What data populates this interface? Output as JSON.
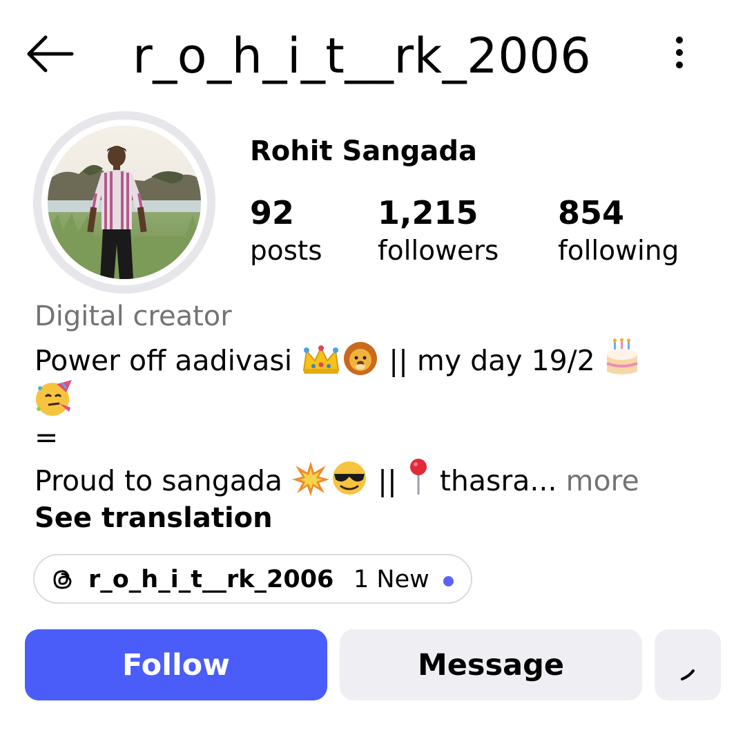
{
  "header": {
    "back_icon": "arrow-left-icon",
    "username": "r_o_h_i_t__rk_2006",
    "more_icon": "vertical-dots-icon"
  },
  "profile": {
    "name": "Rohit Sangada",
    "avatar": "profile-photo"
  },
  "stats": [
    {
      "value": "92",
      "label": "posts"
    },
    {
      "value": "1,215",
      "label": "followers"
    },
    {
      "value": "854",
      "label": "following"
    }
  ],
  "bio": {
    "category": "Digital creator",
    "line1_text": "Power off aadivasi ",
    "line1_after": " || my day 19/2",
    "line3": "=",
    "line4_text": "Proud to sangada ",
    "line4_mid": " || ",
    "line4_end": "thasra... ",
    "more_label": "more",
    "see_translation": "See translation",
    "emojis": [
      "crown",
      "lion",
      "birthday-cake",
      "partying-face",
      "collision",
      "sunglasses-face",
      "round-pushpin"
    ]
  },
  "threads": {
    "icon": "threads-icon",
    "handle": "r_o_h_i_t__rk_2006",
    "new_label": "1 New",
    "dot_color": "#5b63f5"
  },
  "actions": {
    "follow_label": "Follow",
    "message_label": "Message",
    "suggest_icon": "chevron-down-icon"
  },
  "colors": {
    "accent": "#4a5df9",
    "secondary_button": "#efeff3",
    "muted_text": "#737373"
  }
}
